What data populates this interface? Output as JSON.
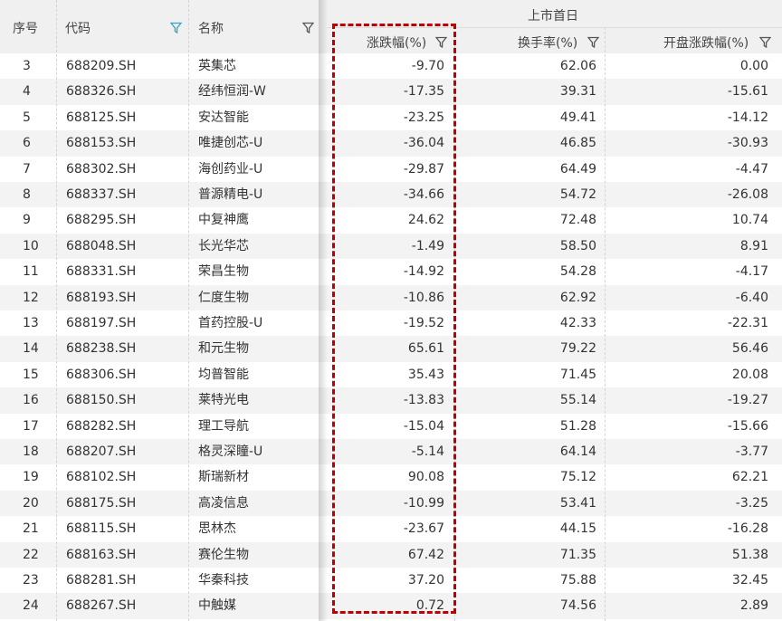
{
  "header": {
    "seq": "序号",
    "code": "代码",
    "name": "名称",
    "group": "上市首日",
    "change": "涨跌幅(%)",
    "turnover": "换手率(%)",
    "open_change": "开盘涨跌幅(%)"
  },
  "colors": {
    "highlight": "#c00000",
    "filter_active": "#2aa6c8"
  },
  "rows": [
    {
      "seq": "3",
      "code": "688209.SH",
      "name": "英集芯",
      "change": "-9.70",
      "turnover": "62.06",
      "open_change": "0.00"
    },
    {
      "seq": "4",
      "code": "688326.SH",
      "name": "经纬恒润-W",
      "change": "-17.35",
      "turnover": "39.31",
      "open_change": "-15.61"
    },
    {
      "seq": "5",
      "code": "688125.SH",
      "name": "安达智能",
      "change": "-23.25",
      "turnover": "49.41",
      "open_change": "-14.12"
    },
    {
      "seq": "6",
      "code": "688153.SH",
      "name": "唯捷创芯-U",
      "change": "-36.04",
      "turnover": "46.85",
      "open_change": "-30.93"
    },
    {
      "seq": "7",
      "code": "688302.SH",
      "name": "海创药业-U",
      "change": "-29.87",
      "turnover": "64.49",
      "open_change": "-4.47"
    },
    {
      "seq": "8",
      "code": "688337.SH",
      "name": "普源精电-U",
      "change": "-34.66",
      "turnover": "54.72",
      "open_change": "-26.08"
    },
    {
      "seq": "9",
      "code": "688295.SH",
      "name": "中复神鹰",
      "change": "24.62",
      "turnover": "72.48",
      "open_change": "10.74"
    },
    {
      "seq": "10",
      "code": "688048.SH",
      "name": "长光华芯",
      "change": "-1.49",
      "turnover": "58.50",
      "open_change": "8.91"
    },
    {
      "seq": "11",
      "code": "688331.SH",
      "name": "荣昌生物",
      "change": "-14.92",
      "turnover": "54.28",
      "open_change": "-4.17"
    },
    {
      "seq": "12",
      "code": "688193.SH",
      "name": "仁度生物",
      "change": "-10.86",
      "turnover": "62.92",
      "open_change": "-6.40"
    },
    {
      "seq": "13",
      "code": "688197.SH",
      "name": "首药控股-U",
      "change": "-19.52",
      "turnover": "42.33",
      "open_change": "-22.31"
    },
    {
      "seq": "14",
      "code": "688238.SH",
      "name": "和元生物",
      "change": "65.61",
      "turnover": "79.22",
      "open_change": "56.46"
    },
    {
      "seq": "15",
      "code": "688306.SH",
      "name": "均普智能",
      "change": "35.43",
      "turnover": "71.45",
      "open_change": "20.08"
    },
    {
      "seq": "16",
      "code": "688150.SH",
      "name": "莱特光电",
      "change": "-13.83",
      "turnover": "55.14",
      "open_change": "-19.27"
    },
    {
      "seq": "17",
      "code": "688282.SH",
      "name": "理工导航",
      "change": "-15.04",
      "turnover": "51.28",
      "open_change": "-15.66"
    },
    {
      "seq": "18",
      "code": "688207.SH",
      "name": "格灵深瞳-U",
      "change": "-5.14",
      "turnover": "64.14",
      "open_change": "-3.77"
    },
    {
      "seq": "19",
      "code": "688102.SH",
      "name": "斯瑞新材",
      "change": "90.08",
      "turnover": "75.12",
      "open_change": "62.21"
    },
    {
      "seq": "20",
      "code": "688175.SH",
      "name": "高凌信息",
      "change": "-10.99",
      "turnover": "53.41",
      "open_change": "-3.25"
    },
    {
      "seq": "21",
      "code": "688115.SH",
      "name": "思林杰",
      "change": "-23.67",
      "turnover": "44.15",
      "open_change": "-16.28"
    },
    {
      "seq": "22",
      "code": "688163.SH",
      "name": "赛伦生物",
      "change": "67.42",
      "turnover": "71.35",
      "open_change": "51.38"
    },
    {
      "seq": "23",
      "code": "688281.SH",
      "name": "华秦科技",
      "change": "37.20",
      "turnover": "75.88",
      "open_change": "32.45"
    },
    {
      "seq": "24",
      "code": "688267.SH",
      "name": "中触媒",
      "change": "0.72",
      "turnover": "74.56",
      "open_change": "2.89"
    }
  ]
}
